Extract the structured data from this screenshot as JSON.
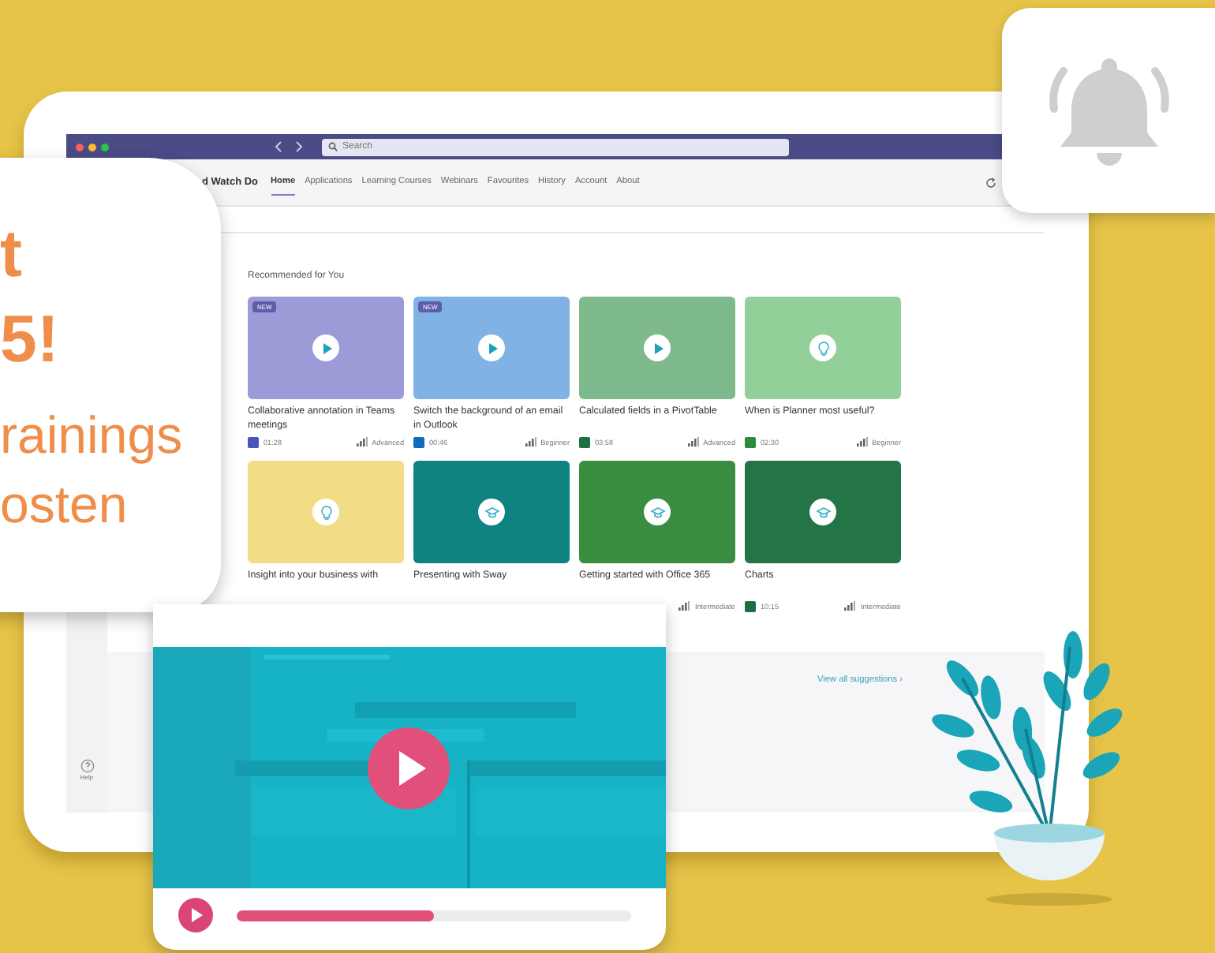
{
  "callout": {
    "lines": [
      {
        "text": "t",
        "kind": "big"
      },
      {
        "text": "5!",
        "kind": "big"
      },
      {
        "text": "rainings",
        "kind": "small"
      },
      {
        "text": "osten",
        "kind": "small"
      }
    ]
  },
  "app": {
    "search": {
      "placeholder": "Search"
    },
    "brand": "d Watch Do",
    "tabs": [
      {
        "label": "Home",
        "selected": true
      },
      {
        "label": "Applications",
        "selected": false
      },
      {
        "label": "Learning Courses",
        "selected": false
      },
      {
        "label": "Webinars",
        "selected": false
      },
      {
        "label": "Favourites",
        "selected": false
      },
      {
        "label": "History",
        "selected": false
      },
      {
        "label": "Account",
        "selected": false
      },
      {
        "label": "About",
        "selected": false
      }
    ],
    "section_title": "Recommended for You",
    "cards": [
      {
        "title": "Collaborative annotation in Teams meetings",
        "color": "#9c9bd8",
        "kind": "play",
        "badge": "NEW",
        "app_icon": {
          "color": "#4b53bc"
        },
        "duration": "01:28",
        "level_label": "Advanced"
      },
      {
        "title": "Switch the background of an email in Outlook",
        "color": "#80b3e3",
        "kind": "play",
        "badge": "NEW",
        "app_icon": {
          "color": "#0f6cbd"
        },
        "duration": "00:46",
        "level_label": "Beginner"
      },
      {
        "title": "Calculated fields in a PivotTable",
        "color": "#7fba8c",
        "kind": "play",
        "app_icon": {
          "color": "#1d7044"
        },
        "duration": "03:58",
        "level_label": "Advanced"
      },
      {
        "title": "When is Planner most useful?",
        "color": "#93cf98",
        "kind": "bulb",
        "app_icon": {
          "color": "#2e8b3a"
        },
        "duration": "02:30",
        "level_label": "Beginner"
      },
      {
        "title": "Insight into your business with",
        "color": "#f2dc86",
        "kind": "bulb"
      },
      {
        "title": "Presenting with Sway",
        "color": "#0f8381",
        "kind": "cap"
      },
      {
        "title": "Getting started with Office 365",
        "color": "#3a8c40",
        "kind": "cap",
        "level_label": "Intermediate"
      },
      {
        "title": "Charts",
        "color": "#237547",
        "kind": "cap",
        "app_icon": {
          "color": "#1d7044"
        },
        "duration": "10:15",
        "level_label": "Intermediate"
      }
    ],
    "view_all": "View all suggestions ›",
    "help": "Help"
  },
  "player": {
    "level": 0.5
  }
}
